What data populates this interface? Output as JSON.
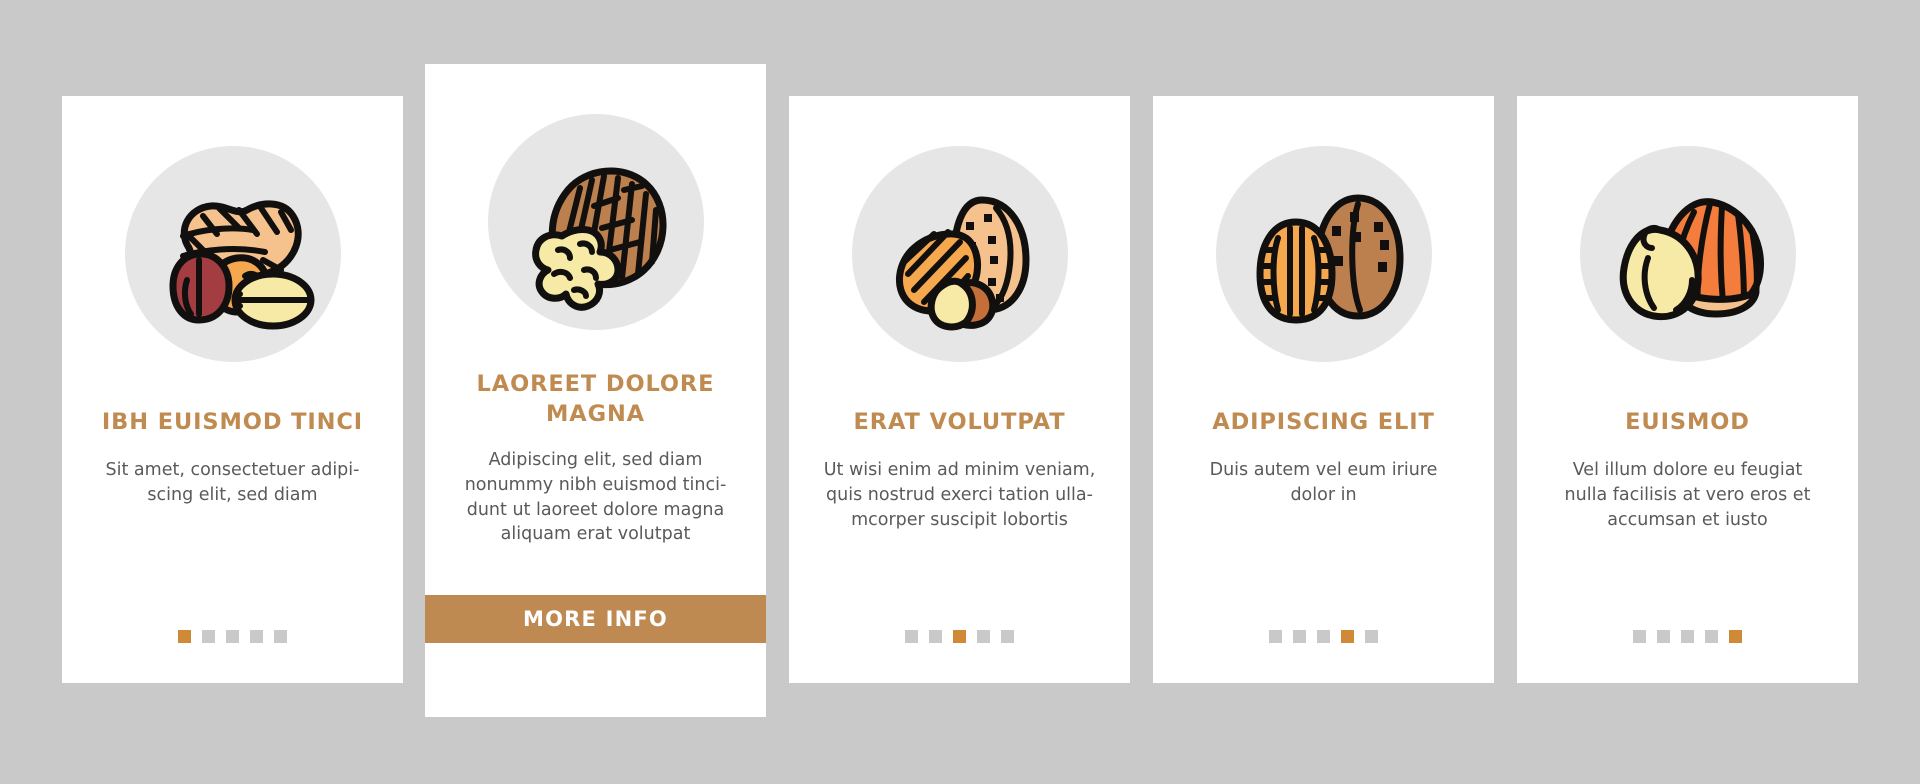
{
  "page": {
    "background_color": "#c9c9c9",
    "accent_color": "#c08b50",
    "dot_active_color": "#d08a37",
    "dot_inactive_color": "#c9c9c9",
    "button_color": "#bf8a51",
    "icon_circle_color": "#e6e6e6",
    "body_text_color": "#5a5a5a"
  },
  "cards": [
    {
      "icon_name": "peanut-icon",
      "title": "IBH EUISMOD TINCI",
      "description": "Sit amet, consectetuer adipi-scing elit, sed diam",
      "dots_total": 5,
      "dot_active_index": 0,
      "featured": false,
      "button_label": null
    },
    {
      "icon_name": "walnut-icon",
      "title": "LAOREET DOLORE MAGNA",
      "description": "Adipiscing elit, sed diam nonummy nibh euismod tinci-dunt ut laoreet dolore magna aliquam erat volutpat",
      "dots_total": 0,
      "dot_active_index": -1,
      "featured": true,
      "button_label": "MORE INFO"
    },
    {
      "icon_name": "almond-icon",
      "title": "ERAT VOLUTPAT",
      "description": "Ut wisi enim ad minim veniam, quis nostrud exerci tation ulla-mcorper suscipit lobortis",
      "dots_total": 5,
      "dot_active_index": 2,
      "featured": false,
      "button_label": null
    },
    {
      "icon_name": "pecan-icon",
      "title": "ADIPISCING ELIT",
      "description": "Duis autem vel eum iriure dolor in",
      "dots_total": 5,
      "dot_active_index": 3,
      "featured": false,
      "button_label": null
    },
    {
      "icon_name": "hazelnut-icon",
      "title": "EUISMOD",
      "description": "Vel illum dolore eu feugiat nulla facilisis at vero eros et accumsan et iusto",
      "dots_total": 5,
      "dot_active_index": 4,
      "featured": false,
      "button_label": null
    }
  ]
}
